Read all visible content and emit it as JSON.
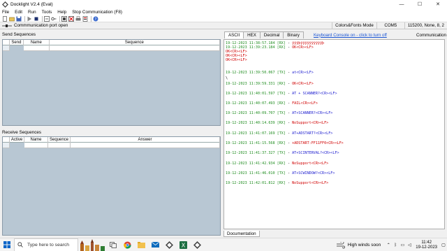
{
  "window": {
    "title": "Docklight V2.4 (Eval)",
    "minimize": "—",
    "maximize": "☐",
    "close": "✕"
  },
  "menu": [
    "File",
    "Edit",
    "Run",
    "Tools",
    "Help",
    "Stop Communication  (F8)"
  ],
  "status_bar": {
    "message": "Commmunication port open",
    "mode": "Colors&Fonts Mode",
    "port": "COM5",
    "settings": "115200, None, 8, 2"
  },
  "send_sequences": {
    "label": "Send Sequences",
    "columns": [
      "Send",
      "Name",
      "Sequence"
    ]
  },
  "receive_sequences": {
    "label": "Receive Sequences",
    "columns": [
      "Active",
      "Name",
      "Sequence",
      "Answer"
    ]
  },
  "tabs": [
    "ASCII",
    "HEX",
    "Decimal",
    "Binary"
  ],
  "keyboard_console_link": "Keyboard Console on - click to turn off",
  "communication_label": "Communication",
  "documentation_tab": "Documentation",
  "console_lines": [
    {
      "ts": "19-12-2023 11:38:57.184",
      "dir": "[RX]",
      "kind": "rx",
      "msg": "ÿÿÿþÿÿÿÿÿÿÿÿÿÿþ"
    },
    {
      "ts": "19-12-2023 11:39:23.184",
      "dir": "[RX]",
      "kind": "rx",
      "msg": "OK<CR><LF>"
    },
    {
      "ts": "",
      "dir": "",
      "kind": "rx",
      "msg": "OK<CR><LF>"
    },
    {
      "ts": "",
      "dir": "",
      "kind": "rx",
      "msg": "OK<CR><LF>"
    },
    {
      "ts": "",
      "dir": "",
      "kind": "rx",
      "msg": "OK<CR><LF>"
    },
    {
      "ts": "19-12-2023 11:39:50.067",
      "dir": "[TX]",
      "kind": "tx",
      "msg": "at<CR><LF>"
    },
    {
      "ts": "",
      "dir": "",
      "kind": "plain",
      "msg": "\\"
    },
    {
      "ts": "19-12-2023 11:39:59.331",
      "dir": "[RX]",
      "kind": "rx",
      "msg": "OK<CR><LF>"
    },
    {
      "ts": "19-12-2023 11:40:01.597",
      "dir": "[TX]",
      "kind": "tx",
      "msg": "AT + SCANNER?<CR><LF>"
    },
    {
      "ts": "19-12-2023 11:40:07.493",
      "dir": "[RX]",
      "kind": "rx",
      "msg": "FAIL<CR><LF>"
    },
    {
      "ts": "19-12-2023 11:40:09.707",
      "dir": "[TX]",
      "kind": "tx",
      "msg": "AT+SCANNER?<CR><LF>"
    },
    {
      "ts": "19-12-2023 11:40:14.639",
      "dir": "[RX]",
      "kind": "rx",
      "msg": "NoSupport<CR><LF>"
    },
    {
      "ts": "19-12-2023 11:41:07.169",
      "dir": "[TX]",
      "kind": "tx",
      "msg": "AT+ADSTART?<CR><LF>"
    },
    {
      "ts": "19-12-2023 11:41:15.568",
      "dir": "[RX]",
      "kind": "rx",
      "msg": "+ADSTART:FF11FF0<CR><LF>"
    },
    {
      "ts": "19-12-2023 11:41:37.327",
      "dir": "[TX]",
      "kind": "tx",
      "msg": "AT+SCINTERVAL?<CR><LF>"
    },
    {
      "ts": "19-12-2023 11:41:42.934",
      "dir": "[RX]",
      "kind": "rx",
      "msg": "NoSupport<CR><LF>"
    },
    {
      "ts": "19-12-2023 11:41:46.010",
      "dir": "[TX]",
      "kind": "tx",
      "msg": "AT+SCWINDOW?<CR><LF>"
    },
    {
      "ts": "19-12-2023 11:42:01.812",
      "dir": "[RX]",
      "kind": "rx",
      "msg": "NoSupport<CR><LF>"
    }
  ],
  "taskbar": {
    "search_placeholder": "Type here to search",
    "weather": "High winds soon",
    "time": "11:42",
    "date": "19-12-2023"
  },
  "colors": {
    "grid_bg": "#b8c7d3",
    "timestamp": "#1e8c1e",
    "rx": "#d00000",
    "tx": "#2020d0",
    "link": "#1a55d4"
  }
}
